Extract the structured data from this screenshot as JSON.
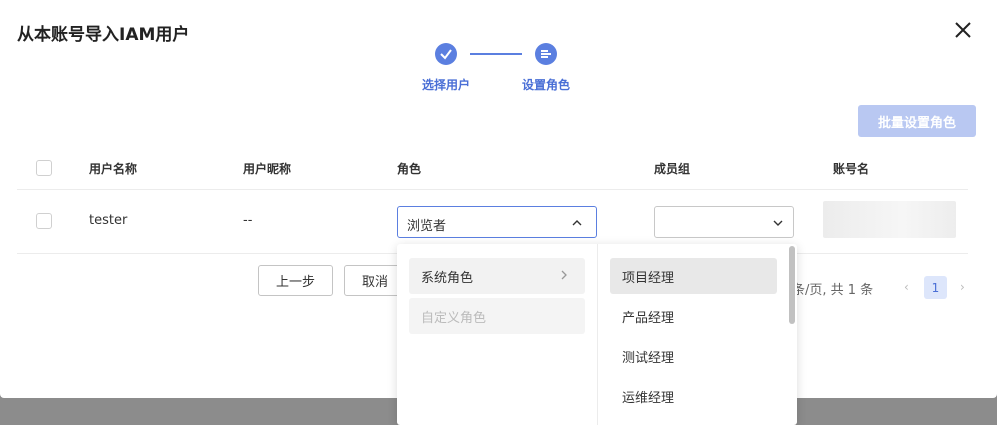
{
  "dialog": {
    "title": "从本账号导入IAM用户"
  },
  "steps": [
    {
      "label": "选择用户",
      "state": "done"
    },
    {
      "label": "设置角色",
      "state": "current"
    }
  ],
  "toolbar": {
    "batch_label": "批量设置角色"
  },
  "table": {
    "columns": [
      "用户名称",
      "用户昵称",
      "角色",
      "成员组",
      "账号名"
    ],
    "rows": [
      {
        "username": "tester",
        "nickname": "--",
        "role": "浏览者",
        "group": ""
      }
    ]
  },
  "footer": {
    "prev_label": "上一步",
    "cancel_label": "取消"
  },
  "pagination": {
    "summary": "条/页, 共 1 条",
    "current_page": "1",
    "prev_arrow": "‹",
    "next_arrow": "›"
  },
  "role_dropdown": {
    "categories": [
      {
        "label": "系统角色",
        "state": "active"
      },
      {
        "label": "自定义角色",
        "state": "disabled"
      }
    ],
    "options": [
      "项目经理",
      "产品经理",
      "测试经理",
      "运维经理"
    ],
    "hovered_option": "项目经理"
  },
  "colors": {
    "accent": "#5b7fe0",
    "accent_disabled": "#b9c8f2",
    "overlay": "#8c8c8c"
  }
}
